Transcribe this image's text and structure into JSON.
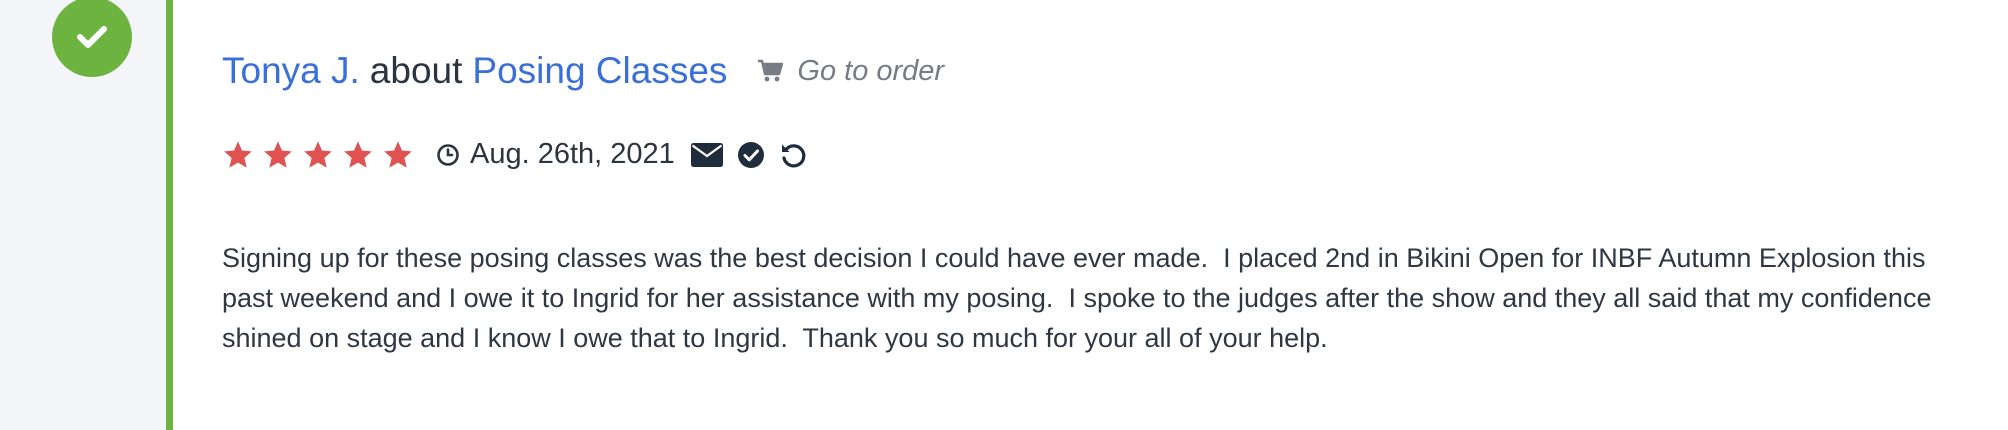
{
  "review": {
    "author": "Tonya J.",
    "about_word": "about",
    "product": "Posing Classes",
    "order_link": "Go to order",
    "rating": 5,
    "rating_max": 5,
    "date": "Aug. 26th, 2021",
    "text": "Signing up for these posing classes was the best decision I could have ever made.  I placed 2nd in Bikini Open for INBF Autumn Explosion this past weekend and I owe it to Ingrid for her assistance with my posing.  I spoke to the judges after the show and they all said that my confidence shined on stage and I know I owe that to Ingrid.  Thank you so much for your all of your help."
  },
  "icons": {
    "status": "check-icon",
    "order": "cart-icon",
    "star": "star-icon",
    "date": "clock-icon",
    "actions": [
      "envelope-icon",
      "check-circle-icon",
      "undo-icon"
    ]
  },
  "colors": {
    "accent_green": "#6db33f",
    "link_blue": "#3a6fd8",
    "star_red": "#e05252",
    "text_dark": "#2c3440",
    "muted_gray": "#777c84"
  }
}
